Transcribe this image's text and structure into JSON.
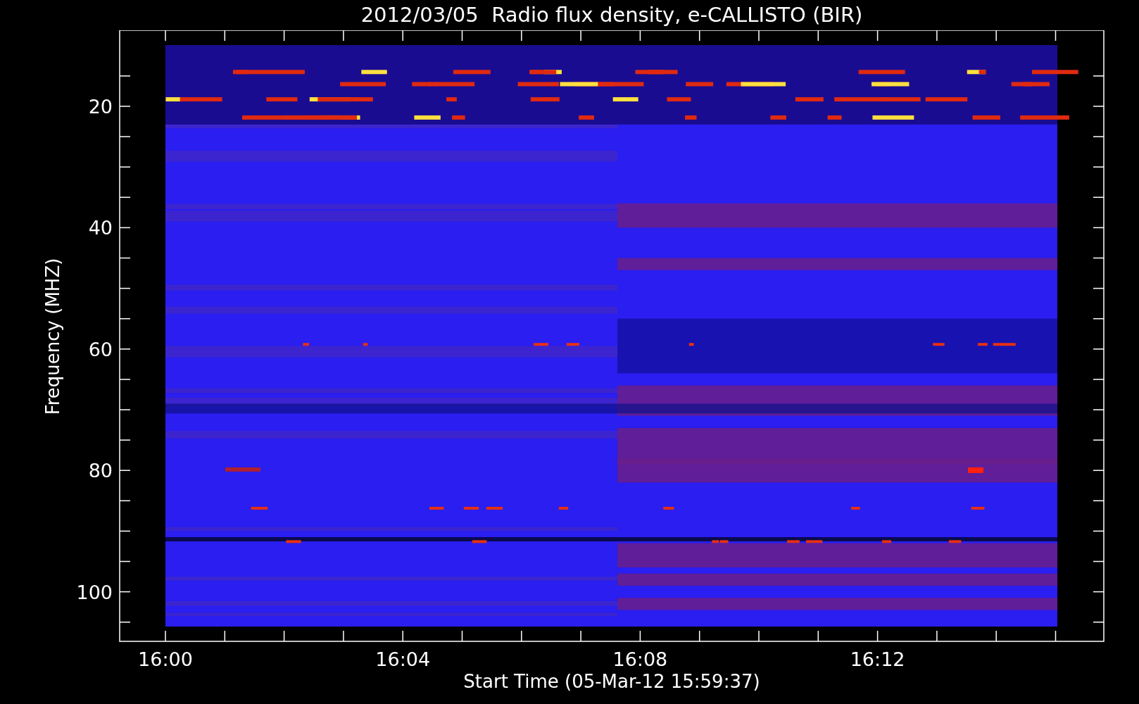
{
  "title": "2012/03/05  Radio flux density, e-CALLISTO (BIR)",
  "y_axis": {
    "label": "Frequency (MHZ)",
    "ticks": [
      "20",
      "40",
      "60",
      "80",
      "100"
    ]
  },
  "x_axis": {
    "label": "Start Time (05-Mar-12 15:59:37)",
    "ticks": [
      "16:00",
      "16:04",
      "16:08",
      "16:12"
    ]
  }
}
